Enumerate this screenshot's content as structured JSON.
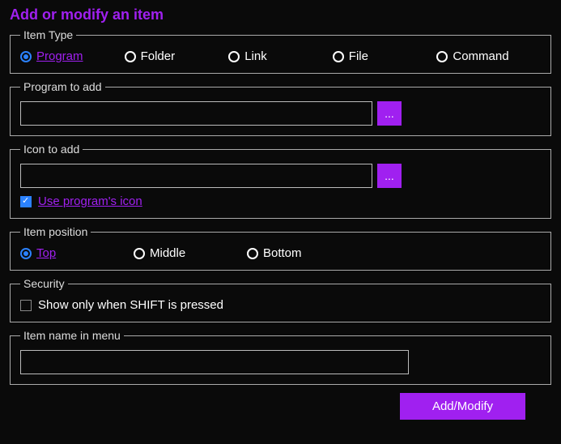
{
  "title": "Add or modify an item",
  "itemType": {
    "legend": "Item Type",
    "options": {
      "program": "Program",
      "folder": "Folder",
      "link": "Link",
      "file": "File",
      "command": "Command"
    }
  },
  "programAdd": {
    "legend": "Program to add",
    "value": "",
    "browse": "..."
  },
  "iconAdd": {
    "legend": "Icon to add",
    "value": "",
    "browse": "...",
    "useProgramIcon": "Use program's icon"
  },
  "position": {
    "legend": "Item position",
    "options": {
      "top": "Top",
      "middle": "Middle",
      "bottom": "Bottom"
    }
  },
  "security": {
    "legend": "Security",
    "shiftOnly": "Show only when SHIFT is pressed"
  },
  "nameInMenu": {
    "legend": "Item name in menu",
    "value": ""
  },
  "actions": {
    "addModify": "Add/Modify"
  }
}
